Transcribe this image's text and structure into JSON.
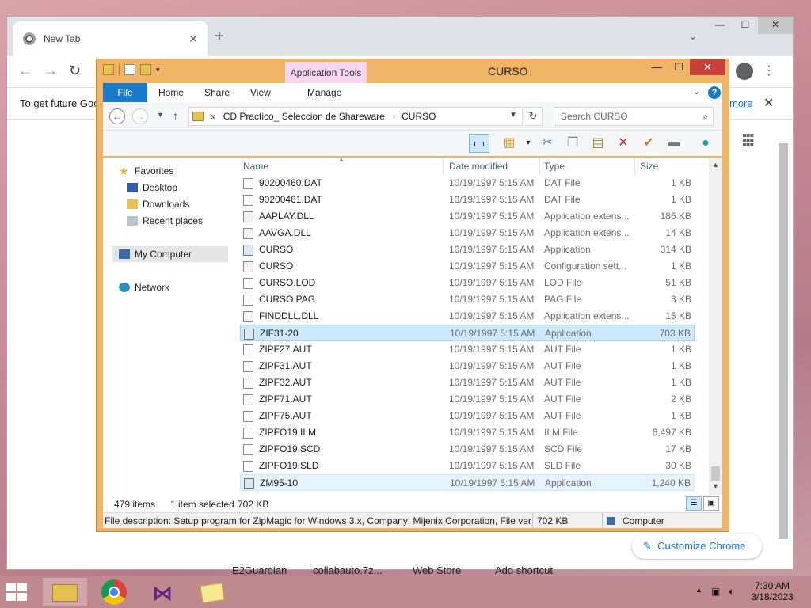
{
  "chrome": {
    "tab_title": "New Tab",
    "infobar_message": "To get future Goo",
    "infobar_more": "more",
    "shortcuts": [
      "E2Guardian",
      "collabauto.7z...",
      "Web Store",
      "Add shortcut"
    ],
    "customize_label": "Customize Chrome"
  },
  "explorer": {
    "title": "CURSO",
    "app_tools_label": "Application Tools",
    "ribbon_tabs": [
      "File",
      "Home",
      "Share",
      "View",
      "Manage"
    ],
    "breadcrumb": [
      "CD Practico_ Seleccion de Shareware",
      "CURSO"
    ],
    "breadcrumb_prefix": "«",
    "search_placeholder": "Search CURSO",
    "nav": {
      "favorites": "Favorites",
      "desktop": "Desktop",
      "downloads": "Downloads",
      "recent": "Recent places",
      "computer": "My Computer",
      "network": "Network"
    },
    "columns": {
      "name": "Name",
      "date": "Date modified",
      "type": "Type",
      "size": "Size"
    },
    "files": [
      {
        "name": "90200460.DAT",
        "date": "10/19/1997 5:15 AM",
        "type": "DAT File",
        "size": "1 KB",
        "kind": "doc",
        "state": ""
      },
      {
        "name": "90200461.DAT",
        "date": "10/19/1997 5:15 AM",
        "type": "DAT File",
        "size": "1 KB",
        "kind": "doc",
        "state": ""
      },
      {
        "name": "AAPLAY.DLL",
        "date": "10/19/1997 5:15 AM",
        "type": "Application extens...",
        "size": "186 KB",
        "kind": "ext",
        "state": ""
      },
      {
        "name": "AAVGA.DLL",
        "date": "10/19/1997 5:15 AM",
        "type": "Application extens...",
        "size": "14 KB",
        "kind": "ext",
        "state": ""
      },
      {
        "name": "CURSO",
        "date": "10/19/1997 5:15 AM",
        "type": "Application",
        "size": "314 KB",
        "kind": "app",
        "state": ""
      },
      {
        "name": "CURSO",
        "date": "10/19/1997 5:15 AM",
        "type": "Configuration sett...",
        "size": "1 KB",
        "kind": "ext",
        "state": ""
      },
      {
        "name": "CURSO.LOD",
        "date": "10/19/1997 5:15 AM",
        "type": "LOD File",
        "size": "51 KB",
        "kind": "doc",
        "state": ""
      },
      {
        "name": "CURSO.PAG",
        "date": "10/19/1997 5:15 AM",
        "type": "PAG File",
        "size": "3 KB",
        "kind": "doc",
        "state": ""
      },
      {
        "name": "FINDDLL.DLL",
        "date": "10/19/1997 5:15 AM",
        "type": "Application extens...",
        "size": "15 KB",
        "kind": "ext",
        "state": ""
      },
      {
        "name": "ZIF31-20",
        "date": "10/19/1997 5:15 AM",
        "type": "Application",
        "size": "703 KB",
        "kind": "app",
        "state": "sel"
      },
      {
        "name": "ZIPF27.AUT",
        "date": "10/19/1997 5:15 AM",
        "type": "AUT File",
        "size": "1 KB",
        "kind": "doc",
        "state": ""
      },
      {
        "name": "ZIPF31.AUT",
        "date": "10/19/1997 5:15 AM",
        "type": "AUT File",
        "size": "1 KB",
        "kind": "doc",
        "state": ""
      },
      {
        "name": "ZIPF32.AUT",
        "date": "10/19/1997 5:15 AM",
        "type": "AUT File",
        "size": "1 KB",
        "kind": "doc",
        "state": ""
      },
      {
        "name": "ZIPF71.AUT",
        "date": "10/19/1997 5:15 AM",
        "type": "AUT File",
        "size": "2 KB",
        "kind": "doc",
        "state": ""
      },
      {
        "name": "ZIPF75.AUT",
        "date": "10/19/1997 5:15 AM",
        "type": "AUT File",
        "size": "1 KB",
        "kind": "doc",
        "state": ""
      },
      {
        "name": "ZIPFO19.ILM",
        "date": "10/19/1997 5:15 AM",
        "type": "ILM File",
        "size": "6,497 KB",
        "kind": "doc",
        "state": ""
      },
      {
        "name": "ZIPFO19.SCD",
        "date": "10/19/1997 5:15 AM",
        "type": "SCD File",
        "size": "17 KB",
        "kind": "doc",
        "state": ""
      },
      {
        "name": "ZIPFO19.SLD",
        "date": "10/19/1997 5:15 AM",
        "type": "SLD File",
        "size": "30 KB",
        "kind": "doc",
        "state": ""
      },
      {
        "name": "ZM95-10",
        "date": "10/19/1997 5:15 AM",
        "type": "Application",
        "size": "1,240 KB",
        "kind": "app",
        "state": "hot"
      }
    ],
    "status": {
      "count": "479 items",
      "selected": "1 item selected",
      "sel_size": "702 KB"
    },
    "details": {
      "description": "File description: Setup program for ZipMagic for Windows 3.x, Company: Mijenix Corporation, File vers",
      "size": "702 KB",
      "location": "Computer"
    }
  },
  "taskbar": {
    "time": "7:30 AM",
    "date": "3/18/2023"
  }
}
